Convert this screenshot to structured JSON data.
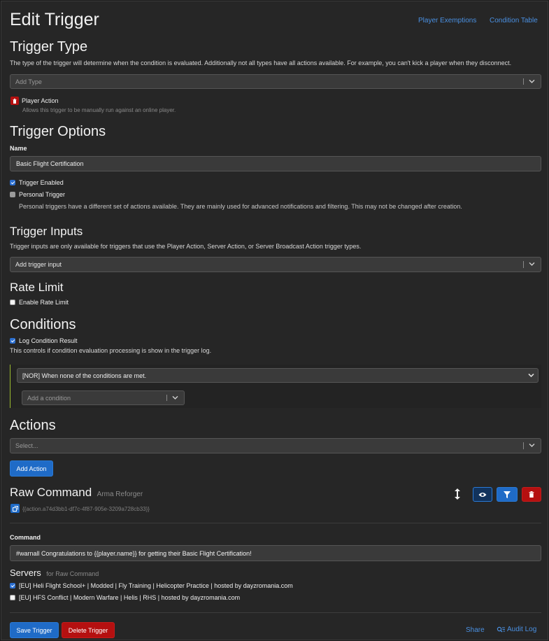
{
  "header": {
    "title": "Edit Trigger",
    "links": {
      "player_exemptions": "Player Exemptions",
      "condition_table": "Condition Table"
    }
  },
  "trigger_type": {
    "heading": "Trigger Type",
    "description": "The type of the trigger will determine when the condition is evaluated. Additionally not all types have all actions available. For example, you can't kick a player when they disconnect.",
    "select_placeholder": "Add Type",
    "selected_type": {
      "label": "Player Action",
      "description": "Allows this trigger to be manually run against an online player."
    }
  },
  "trigger_options": {
    "heading": "Trigger Options",
    "name_label": "Name",
    "name_value": "Basic Flight Certification",
    "enabled_label": "Trigger Enabled",
    "enabled_checked": true,
    "personal_label": "Personal Trigger",
    "personal_checked": false,
    "personal_help": "Personal triggers have a different set of actions available. They are mainly used for advanced notifications and filtering. This may not be changed after creation."
  },
  "trigger_inputs": {
    "heading": "Trigger Inputs",
    "description": "Trigger inputs are only available for triggers that use the Player Action, Server Action, or Server Broadcast Action trigger types.",
    "select_placeholder": "Add trigger input"
  },
  "rate_limit": {
    "heading": "Rate Limit",
    "enable_label": "Enable Rate Limit",
    "enable_checked": false
  },
  "conditions": {
    "heading": "Conditions",
    "log_label": "Log Condition Result",
    "log_checked": true,
    "log_help": "This controls if condition evaluation processing is show in the trigger log.",
    "operator_value": "[NOR] When none of the conditions are met.",
    "add_placeholder": "Add a condition"
  },
  "actions": {
    "heading": "Actions",
    "select_placeholder": "Select...",
    "add_button": "Add Action",
    "item": {
      "title": "Raw Command",
      "subtitle": "Arma Reforger",
      "id_text": "{{action.a74d3bb1-df7c-4f87-905e-3209a728cb33}}",
      "icons": {
        "move": "move-vertical-icon",
        "view": "eye-icon",
        "filter": "filter-icon",
        "delete": "trash-icon"
      },
      "command_label": "Command",
      "command_value": "#warnall Congratulations to {{player.name}} for getting their Basic Flight Certification!",
      "servers_heading": "Servers",
      "servers_sub": "for Raw Command",
      "servers": [
        {
          "label": "[EU] Heli Flight School+ | Modded | Fly Training | Helicopter Practice | hosted by dayzromania.com",
          "checked": true
        },
        {
          "label": "[EU] HFS Conflict | Modern Warfare | Helis | RHS | hosted by dayzromania.com",
          "checked": false
        }
      ]
    }
  },
  "footer": {
    "save": "Save Trigger",
    "delete": "Delete Trigger",
    "share": "Share",
    "audit": "Audit Log"
  },
  "colors": {
    "accent": "#1f6bc7",
    "danger": "#b51010",
    "link": "#4a90e2",
    "background": "#262626"
  }
}
